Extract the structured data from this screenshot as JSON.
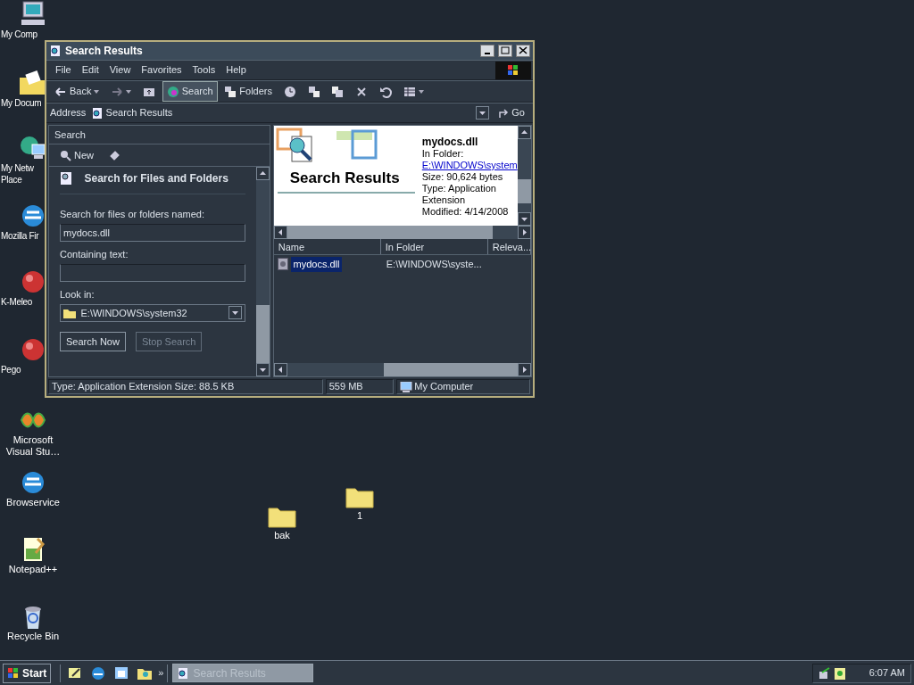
{
  "desktop_icons": [
    {
      "label": "My Comp",
      "kind": "computer"
    },
    {
      "label": "My Docum",
      "kind": "docs"
    },
    {
      "label": "My Netw\nPlace",
      "kind": "network"
    },
    {
      "label": "Mozilla Fir",
      "kind": "browser"
    },
    {
      "label": "K-Meleo",
      "kind": "ball"
    },
    {
      "label": "Pego",
      "kind": "ball"
    },
    {
      "label": "Microsoft\nVisual Stu…",
      "kind": "studio"
    },
    {
      "label": "Browservice",
      "kind": "browser"
    },
    {
      "label": "Notepad++",
      "kind": "notepad"
    },
    {
      "label": "Recycle Bin",
      "kind": "bin"
    },
    {
      "label": "bak",
      "kind": "folder"
    },
    {
      "label": "1",
      "kind": "folder"
    }
  ],
  "window": {
    "title": "Search Results",
    "menu": [
      "File",
      "Edit",
      "View",
      "Favorites",
      "Tools",
      "Help"
    ],
    "toolbar": [
      {
        "kind": "back",
        "label": "Back",
        "selected": false
      },
      {
        "kind": "forward",
        "selected": false
      },
      {
        "kind": "up",
        "selected": false
      },
      {
        "kind": "search",
        "label": "Search",
        "selected": true
      },
      {
        "kind": "folders",
        "label": "Folders",
        "selected": false
      },
      {
        "kind": "history",
        "selected": false
      },
      {
        "kind": "move",
        "selected": false
      },
      {
        "kind": "copy",
        "selected": false
      },
      {
        "kind": "delete",
        "selected": false
      },
      {
        "kind": "undo",
        "selected": false
      },
      {
        "kind": "views",
        "selected": false
      }
    ],
    "address": {
      "label": "Address",
      "value": "Search Results",
      "go": "Go"
    },
    "search_pane": {
      "header": "Search",
      "new": "New",
      "title": "Search for Files and Folders",
      "name_label": "Search for files or folders named:",
      "name_value": "mydocs.dll",
      "text_label": "Containing text:",
      "look_in_label": "Look in:",
      "look_in_value": "E:\\WINDOWS\\system32",
      "buttons": [
        {
          "label": "Search Now",
          "disabled": false
        },
        {
          "label": "Stop Search",
          "disabled": true
        }
      ]
    },
    "preview": {
      "banner": "Search Results",
      "file": "mydocs.dll",
      "folder_label": "In Folder:",
      "folder_link": "E:\\WINDOWS\\system",
      "lines": [
        "Size: 90,624 bytes",
        "Type: Application Extension",
        "Modified: 4/14/2008"
      ]
    },
    "results": {
      "columns": [
        "Name",
        "In Folder",
        "Releva..."
      ],
      "rows": [
        {
          "name": "mydocs.dll",
          "folder": "E:\\WINDOWS\\syste...",
          "selected": true
        }
      ]
    },
    "status_bar": [
      "Type: Application Extension Size: 88.5 KB",
      "559 MB",
      "My Computer"
    ]
  },
  "taskbar": {
    "start": "Start",
    "more": "»",
    "tasks": [
      {
        "label": "Search Results",
        "selected": true
      }
    ],
    "clock": "6:07 AM"
  }
}
